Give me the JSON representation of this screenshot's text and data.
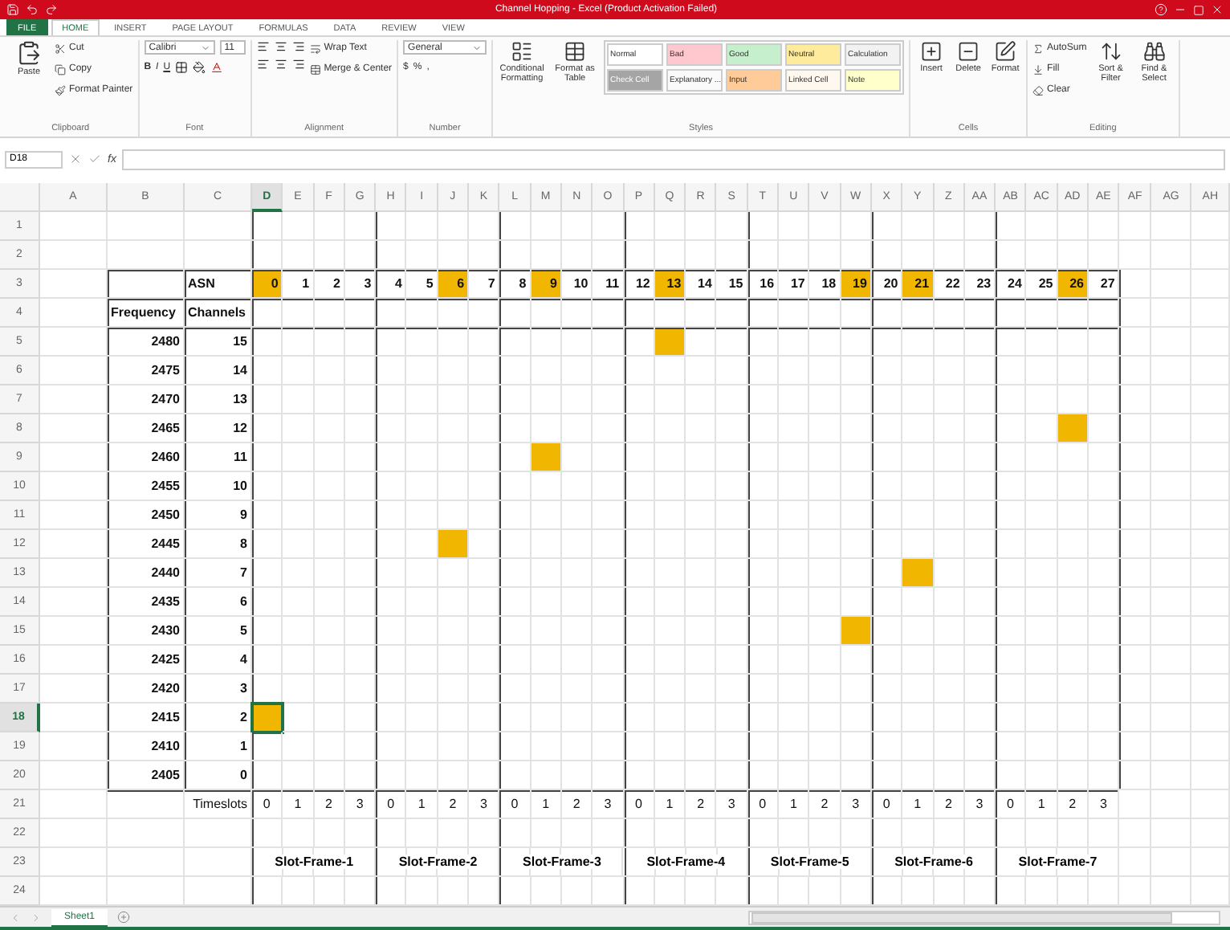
{
  "window": {
    "title": "Channel Hopping - Excel (Product Activation Failed)"
  },
  "ribbon": {
    "tabs": [
      {
        "label": "FILE",
        "kind": "file",
        "selected": false
      },
      {
        "label": "HOME",
        "kind": "tab",
        "selected": true
      },
      {
        "label": "INSERT",
        "kind": "tab",
        "selected": false
      },
      {
        "label": "PAGE LAYOUT",
        "kind": "tab",
        "selected": false
      },
      {
        "label": "FORMULAS",
        "kind": "tab",
        "selected": false
      },
      {
        "label": "DATA",
        "kind": "tab",
        "selected": false
      },
      {
        "label": "REVIEW",
        "kind": "tab",
        "selected": false
      },
      {
        "label": "VIEW",
        "kind": "tab",
        "selected": false
      }
    ],
    "groups": [
      {
        "kind": "clipboard",
        "label": "Clipboard",
        "large": [
          "Paste"
        ],
        "small": [
          "Cut",
          "Copy",
          "Format Painter"
        ]
      },
      {
        "kind": "font",
        "label": "Font",
        "fields": [
          "Calibri",
          "11"
        ],
        "small": [
          "B",
          "I",
          "U"
        ]
      },
      {
        "kind": "alignment",
        "label": "Alignment",
        "small": [
          "Wrap Text",
          "Merge & Center"
        ]
      },
      {
        "kind": "number",
        "label": "Number",
        "fields": [
          "General"
        ],
        "small": [
          "$",
          "%",
          ","
        ]
      },
      {
        "kind": "styles",
        "label": "Styles",
        "large": [
          "Conditional Formatting",
          "Format as Table"
        ],
        "styles": [
          {
            "label": "Normal",
            "color": "#ffffff"
          },
          {
            "label": "Bad",
            "color": "#ffc7ce"
          },
          {
            "label": "Good",
            "color": "#c6efce"
          },
          {
            "label": "Neutral",
            "color": "#ffeb9c"
          },
          {
            "label": "Calculation",
            "color": "#f2f2f2"
          },
          {
            "label": "Check Cell",
            "color": "#a5a5a5"
          },
          {
            "label": "Explanatory ...",
            "color": "#fafafa"
          },
          {
            "label": "Input",
            "color": "#ffcc99"
          },
          {
            "label": "Linked Cell",
            "color": "#fff8ee"
          },
          {
            "label": "Note",
            "color": "#ffffcc"
          }
        ]
      },
      {
        "kind": "cells",
        "label": "Cells",
        "large": [
          "Insert",
          "Delete",
          "Format"
        ]
      },
      {
        "kind": "editing",
        "label": "Editing",
        "small": [
          "AutoSum",
          "Fill",
          "Clear"
        ],
        "large": [
          "Sort & Filter",
          "Find & Select"
        ]
      }
    ]
  },
  "formula_bar": {
    "name_box": "D18",
    "function_label": "fx"
  },
  "sheet": {
    "columns": [
      {
        "label": "A",
        "selected": false
      },
      {
        "label": "B",
        "selected": false
      },
      {
        "label": "C",
        "selected": false
      },
      {
        "label": "D",
        "selected": true
      },
      {
        "label": "E",
        "selected": false
      },
      {
        "label": "F",
        "selected": false
      },
      {
        "label": "G",
        "selected": false
      },
      {
        "label": "H",
        "selected": false
      },
      {
        "label": "I",
        "selected": false
      },
      {
        "label": "J",
        "selected": false
      },
      {
        "label": "K",
        "selected": false
      },
      {
        "label": "L",
        "selected": false
      },
      {
        "label": "M",
        "selected": false
      },
      {
        "label": "N",
        "selected": false
      },
      {
        "label": "O",
        "selected": false
      },
      {
        "label": "P",
        "selected": false
      },
      {
        "label": "Q",
        "selected": false
      },
      {
        "label": "R",
        "selected": false
      },
      {
        "label": "S",
        "selected": false
      },
      {
        "label": "T",
        "selected": false
      },
      {
        "label": "U",
        "selected": false
      },
      {
        "label": "V",
        "selected": false
      },
      {
        "label": "W",
        "selected": false
      },
      {
        "label": "X",
        "selected": false
      },
      {
        "label": "Y",
        "selected": false
      },
      {
        "label": "Z",
        "selected": false
      },
      {
        "label": "AA",
        "selected": false
      },
      {
        "label": "AB",
        "selected": false
      },
      {
        "label": "AC",
        "selected": false
      },
      {
        "label": "AD",
        "selected": false
      },
      {
        "label": "AE",
        "selected": false
      },
      {
        "label": "AF",
        "selected": false
      },
      {
        "label": "AG",
        "selected": false
      },
      {
        "label": "AH",
        "selected": false
      }
    ],
    "rows": [
      {
        "label": "1",
        "selected": false
      },
      {
        "label": "2",
        "selected": false
      },
      {
        "label": "3",
        "selected": false
      },
      {
        "label": "4",
        "selected": false
      },
      {
        "label": "5",
        "selected": false
      },
      {
        "label": "6",
        "selected": false
      },
      {
        "label": "7",
        "selected": false
      },
      {
        "label": "8",
        "selected": false
      },
      {
        "label": "9",
        "selected": false
      },
      {
        "label": "10",
        "selected": false
      },
      {
        "label": "11",
        "selected": false
      },
      {
        "label": "12",
        "selected": false
      },
      {
        "label": "13",
        "selected": false
      },
      {
        "label": "14",
        "selected": false
      },
      {
        "label": "15",
        "selected": false
      },
      {
        "label": "16",
        "selected": false
      },
      {
        "label": "17",
        "selected": false
      },
      {
        "label": "18",
        "selected": true
      },
      {
        "label": "19",
        "selected": false
      },
      {
        "label": "20",
        "selected": false
      },
      {
        "label": "21",
        "selected": false
      },
      {
        "label": "22",
        "selected": false
      },
      {
        "label": "23",
        "selected": false
      },
      {
        "label": "24",
        "selected": false
      }
    ],
    "asn_heading": "ASN",
    "asn": [
      {
        "label": "0",
        "selected": true
      },
      {
        "label": "1",
        "selected": false
      },
      {
        "label": "2",
        "selected": false
      },
      {
        "label": "3",
        "selected": false
      },
      {
        "label": "4",
        "selected": false
      },
      {
        "label": "5",
        "selected": false
      },
      {
        "label": "6",
        "selected": true
      },
      {
        "label": "7",
        "selected": false
      },
      {
        "label": "8",
        "selected": false
      },
      {
        "label": "9",
        "selected": true
      },
      {
        "label": "10",
        "selected": false
      },
      {
        "label": "11",
        "selected": false
      },
      {
        "label": "12",
        "selected": false
      },
      {
        "label": "13",
        "selected": true
      },
      {
        "label": "14",
        "selected": false
      },
      {
        "label": "15",
        "selected": false
      },
      {
        "label": "16",
        "selected": false
      },
      {
        "label": "17",
        "selected": false
      },
      {
        "label": "18",
        "selected": false
      },
      {
        "label": "19",
        "selected": true
      },
      {
        "label": "20",
        "selected": false
      },
      {
        "label": "21",
        "selected": true
      },
      {
        "label": "22",
        "selected": false
      },
      {
        "label": "23",
        "selected": false
      },
      {
        "label": "24",
        "selected": false
      },
      {
        "label": "25",
        "selected": false
      },
      {
        "label": "26",
        "selected": true
      },
      {
        "label": "27",
        "selected": false
      }
    ],
    "frequency_heading": "Frequency",
    "channels_heading": "Channels",
    "channels": [
      {
        "frequency": "2480",
        "channel": "15",
        "slots": [
          false,
          false,
          false,
          false,
          false,
          false,
          false,
          false,
          false,
          false,
          false,
          false,
          false,
          true,
          false,
          false,
          false,
          false,
          false,
          false,
          false,
          false,
          false,
          false,
          false,
          false,
          false,
          false
        ]
      },
      {
        "frequency": "2475",
        "channel": "14",
        "slots": [
          false,
          false,
          false,
          false,
          false,
          false,
          false,
          false,
          false,
          false,
          false,
          false,
          false,
          false,
          false,
          false,
          false,
          false,
          false,
          false,
          false,
          false,
          false,
          false,
          false,
          false,
          false,
          false
        ]
      },
      {
        "frequency": "2470",
        "channel": "13",
        "slots": [
          false,
          false,
          false,
          false,
          false,
          false,
          false,
          false,
          false,
          false,
          false,
          false,
          false,
          false,
          false,
          false,
          false,
          false,
          false,
          false,
          false,
          false,
          false,
          false,
          false,
          false,
          false,
          false
        ]
      },
      {
        "frequency": "2465",
        "channel": "12",
        "slots": [
          false,
          false,
          false,
          false,
          false,
          false,
          false,
          false,
          false,
          false,
          false,
          false,
          false,
          false,
          false,
          false,
          false,
          false,
          false,
          false,
          false,
          false,
          false,
          false,
          false,
          false,
          true,
          false
        ]
      },
      {
        "frequency": "2460",
        "channel": "11",
        "slots": [
          false,
          false,
          false,
          false,
          false,
          false,
          false,
          false,
          false,
          true,
          false,
          false,
          false,
          false,
          false,
          false,
          false,
          false,
          false,
          false,
          false,
          false,
          false,
          false,
          false,
          false,
          false,
          false
        ]
      },
      {
        "frequency": "2455",
        "channel": "10",
        "slots": [
          false,
          false,
          false,
          false,
          false,
          false,
          false,
          false,
          false,
          false,
          false,
          false,
          false,
          false,
          false,
          false,
          false,
          false,
          false,
          false,
          false,
          false,
          false,
          false,
          false,
          false,
          false,
          false
        ]
      },
      {
        "frequency": "2450",
        "channel": "9",
        "slots": [
          false,
          false,
          false,
          false,
          false,
          false,
          false,
          false,
          false,
          false,
          false,
          false,
          false,
          false,
          false,
          false,
          false,
          false,
          false,
          false,
          false,
          false,
          false,
          false,
          false,
          false,
          false,
          false
        ]
      },
      {
        "frequency": "2445",
        "channel": "8",
        "slots": [
          false,
          false,
          false,
          false,
          false,
          false,
          true,
          false,
          false,
          false,
          false,
          false,
          false,
          false,
          false,
          false,
          false,
          false,
          false,
          false,
          false,
          false,
          false,
          false,
          false,
          false,
          false,
          false
        ]
      },
      {
        "frequency": "2440",
        "channel": "7",
        "slots": [
          false,
          false,
          false,
          false,
          false,
          false,
          false,
          false,
          false,
          false,
          false,
          false,
          false,
          false,
          false,
          false,
          false,
          false,
          false,
          false,
          false,
          true,
          false,
          false,
          false,
          false,
          false,
          false
        ]
      },
      {
        "frequency": "2435",
        "channel": "6",
        "slots": [
          false,
          false,
          false,
          false,
          false,
          false,
          false,
          false,
          false,
          false,
          false,
          false,
          false,
          false,
          false,
          false,
          false,
          false,
          false,
          false,
          false,
          false,
          false,
          false,
          false,
          false,
          false,
          false
        ]
      },
      {
        "frequency": "2430",
        "channel": "5",
        "slots": [
          false,
          false,
          false,
          false,
          false,
          false,
          false,
          false,
          false,
          false,
          false,
          false,
          false,
          false,
          false,
          false,
          false,
          false,
          false,
          true,
          false,
          false,
          false,
          false,
          false,
          false,
          false,
          false
        ]
      },
      {
        "frequency": "2425",
        "channel": "4",
        "slots": [
          false,
          false,
          false,
          false,
          false,
          false,
          false,
          false,
          false,
          false,
          false,
          false,
          false,
          false,
          false,
          false,
          false,
          false,
          false,
          false,
          false,
          false,
          false,
          false,
          false,
          false,
          false,
          false
        ]
      },
      {
        "frequency": "2420",
        "channel": "3",
        "slots": [
          false,
          false,
          false,
          false,
          false,
          false,
          false,
          false,
          false,
          false,
          false,
          false,
          false,
          false,
          false,
          false,
          false,
          false,
          false,
          false,
          false,
          false,
          false,
          false,
          false,
          false,
          false,
          false
        ]
      },
      {
        "frequency": "2415",
        "channel": "2",
        "slots": [
          true,
          false,
          false,
          false,
          false,
          false,
          false,
          false,
          false,
          false,
          false,
          false,
          false,
          false,
          false,
          false,
          false,
          false,
          false,
          false,
          false,
          false,
          false,
          false,
          false,
          false,
          false,
          false
        ]
      },
      {
        "frequency": "2410",
        "channel": "1",
        "slots": [
          false,
          false,
          false,
          false,
          false,
          false,
          false,
          false,
          false,
          false,
          false,
          false,
          false,
          false,
          false,
          false,
          false,
          false,
          false,
          false,
          false,
          false,
          false,
          false,
          false,
          false,
          false,
          false
        ]
      },
      {
        "frequency": "2405",
        "channel": "0",
        "slots": [
          false,
          false,
          false,
          false,
          false,
          false,
          false,
          false,
          false,
          false,
          false,
          false,
          false,
          false,
          false,
          false,
          false,
          false,
          false,
          false,
          false,
          false,
          false,
          false,
          false,
          false,
          false,
          false
        ]
      }
    ],
    "timeslots_heading": "Timeslots",
    "timeslots": [
      "0",
      "1",
      "2",
      "3",
      "0",
      "1",
      "2",
      "3",
      "0",
      "1",
      "2",
      "3",
      "0",
      "1",
      "2",
      "3",
      "0",
      "1",
      "2",
      "3",
      "0",
      "1",
      "2",
      "3",
      "0",
      "1",
      "2",
      "3"
    ],
    "slot_frames": [
      "Slot-Frame-1",
      "Slot-Frame-2",
      "Slot-Frame-3",
      "Slot-Frame-4",
      "Slot-Frame-5",
      "Slot-Frame-6",
      "Slot-Frame-7"
    ]
  },
  "sheet_tabs": [
    {
      "label": "Sheet1",
      "selected": true
    }
  ]
}
